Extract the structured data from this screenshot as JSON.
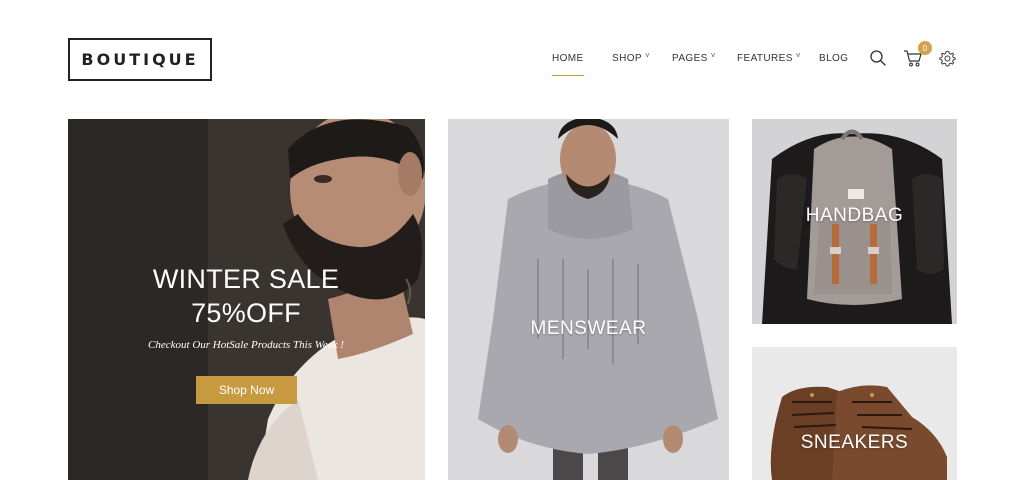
{
  "header": {
    "logo_text": "BOUTIQUE",
    "nav": [
      {
        "label": "HOME",
        "active": true,
        "dropdown": false
      },
      {
        "label": "SHOP",
        "active": false,
        "dropdown": true
      },
      {
        "label": "PAGES",
        "active": false,
        "dropdown": true
      },
      {
        "label": "FEATURES",
        "active": false,
        "dropdown": true
      },
      {
        "label": "BLOG",
        "active": false,
        "dropdown": false
      }
    ],
    "icons": [
      "search-icon",
      "cart-icon",
      "settings-gear-icon"
    ],
    "cart_count": "0",
    "dropdown_glyph": "˅"
  },
  "hero": {
    "title_line1": "WINTER SALE",
    "title_line2": "75%OFF",
    "subtitle": "Checkout Our HotSale Products This Week !",
    "button_label": "Shop Now"
  },
  "categories": {
    "menswear": "MENSWEAR",
    "handbag": "HANDBAG",
    "sneakers": "SNEAKERS"
  },
  "colors": {
    "accent": "#c79a3f",
    "badge": "#d3a14b",
    "text": "#222222"
  }
}
